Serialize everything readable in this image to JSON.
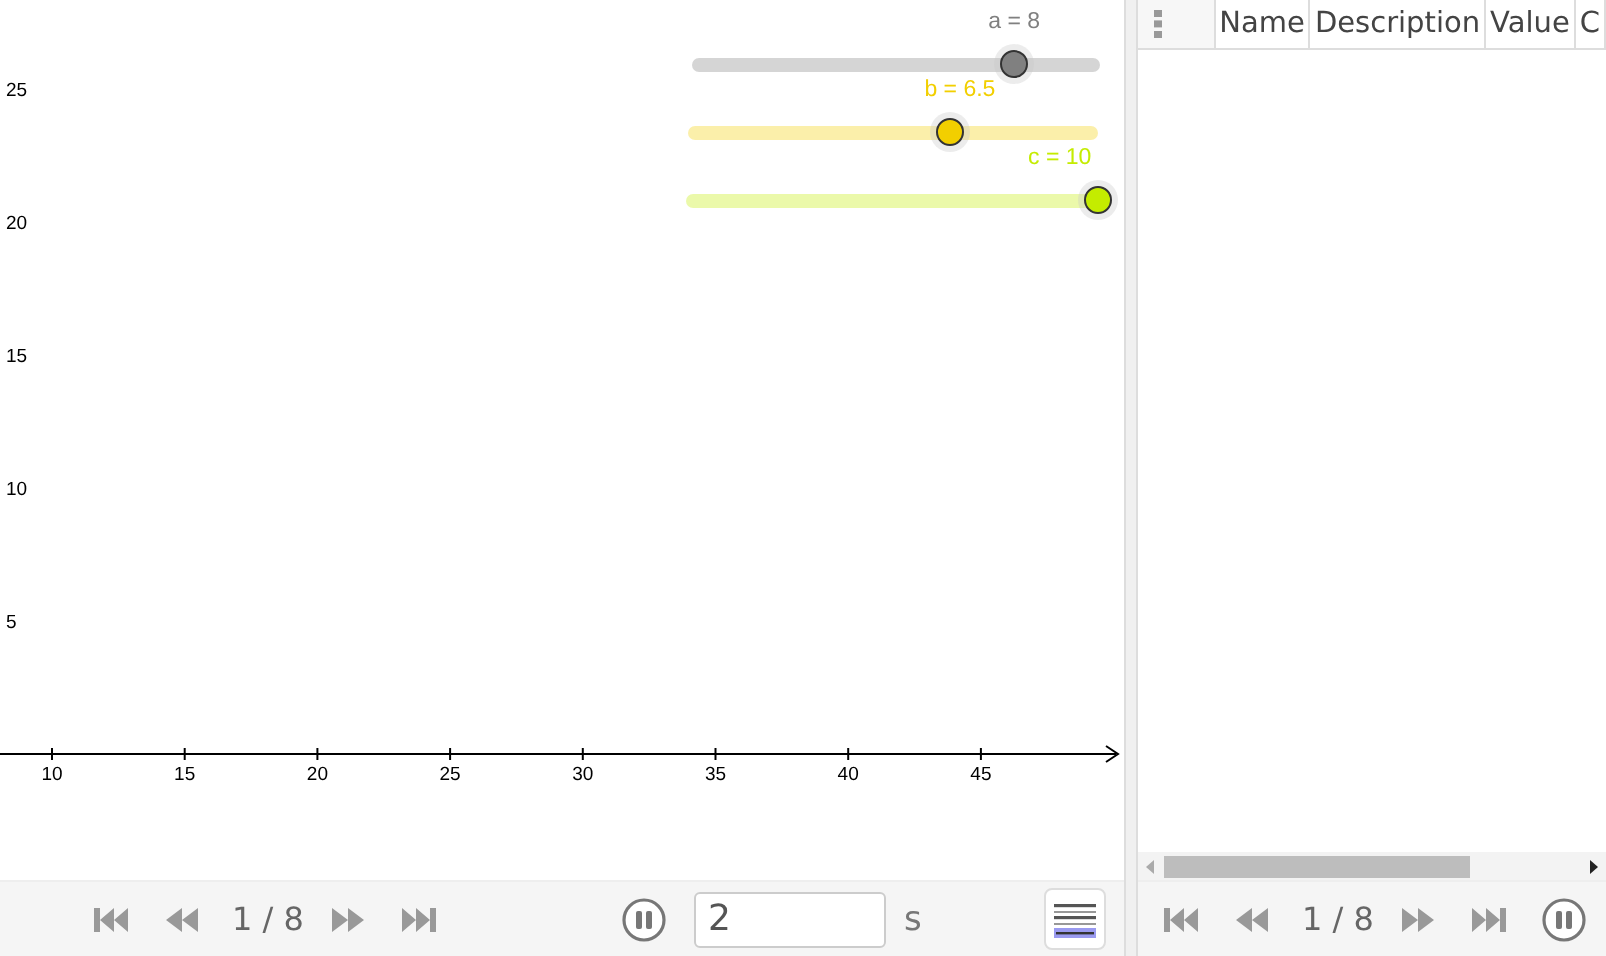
{
  "graphics": {
    "sliders": [
      {
        "label": "a = 8",
        "level": 0.79,
        "color": "#808080"
      },
      {
        "label": "b = 6.5",
        "level": 0.64,
        "color": "#f2cf00"
      },
      {
        "label": "c = 10",
        "level": 1.0,
        "color": "#c4ec00"
      }
    ],
    "x_axis_labels": [
      "10",
      "15",
      "20",
      "25",
      "30",
      "35",
      "40",
      "45"
    ],
    "y_axis_labels": [
      "25",
      "20",
      "15",
      "10",
      "5"
    ]
  },
  "graphics_toolbar": {
    "step": "1 / 8",
    "playing": true,
    "speed": "2",
    "unit": "s"
  },
  "table": {
    "columns": [
      "Name",
      "Description",
      "Value",
      "C"
    ]
  },
  "table_toolbar": {
    "step": "1 / 8",
    "playing": true
  }
}
